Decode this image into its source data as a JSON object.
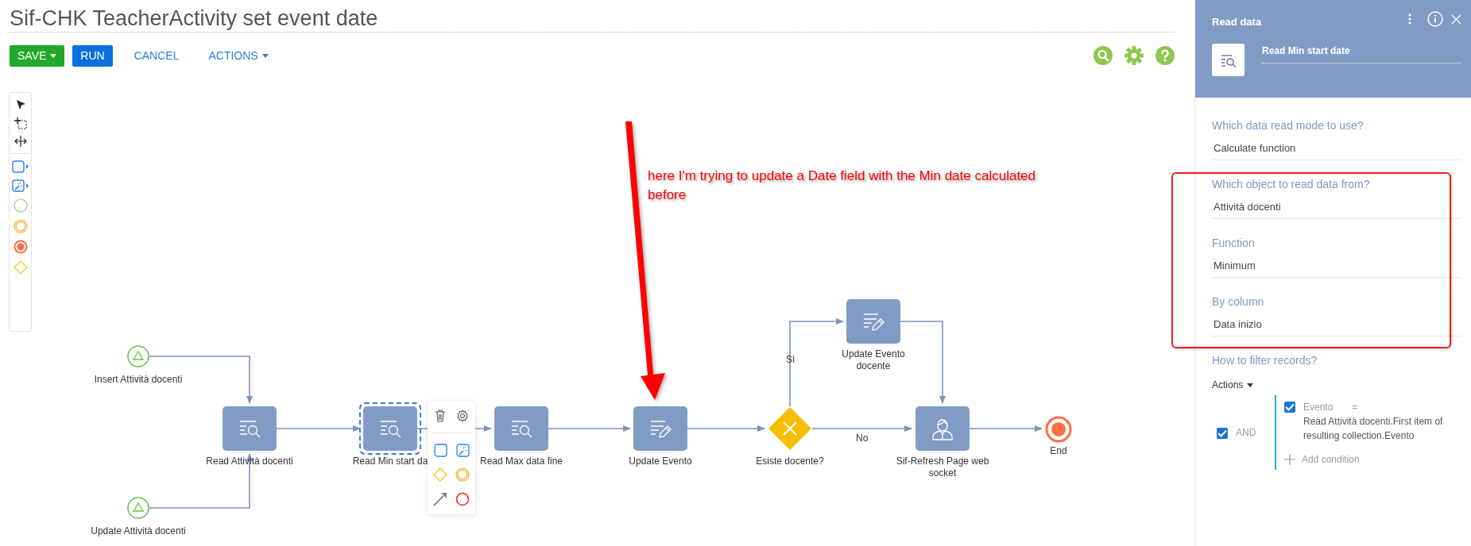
{
  "title": "Sif-CHK TeacherActivity set event date",
  "toolbar": {
    "buttons": [
      {
        "label": "SAVE",
        "kind": "primary-dropdown"
      },
      {
        "label": "RUN",
        "kind": "primary"
      },
      {
        "label": "CANCEL",
        "kind": "link"
      },
      {
        "label": "ACTIONS",
        "kind": "link-dropdown"
      }
    ]
  },
  "diagram": {
    "nodes": [
      {
        "kind": "start",
        "label": "Insert Attività docenti",
        "selected": false
      },
      {
        "kind": "start",
        "label": "Update Attività docenti",
        "selected": false
      },
      {
        "kind": "read",
        "label": "Read Attività docenti",
        "selected": false
      },
      {
        "kind": "read",
        "label": "Read Min start da",
        "selected": true
      },
      {
        "kind": "read",
        "label": "Read Max data fine",
        "selected": false
      },
      {
        "kind": "update",
        "label": "Update Evento",
        "selected": false
      },
      {
        "kind": "gateway",
        "label": "Esiste docente?",
        "selected": false
      },
      {
        "kind": "update",
        "label": "Update Evento docente",
        "selected": false
      },
      {
        "kind": "user",
        "label": "Sif-Refresh Page web socket",
        "selected": false
      },
      {
        "kind": "end",
        "label": "End",
        "selected": false
      }
    ],
    "flow_labels": [
      "Sì",
      "No"
    ]
  },
  "annotation": {
    "text": "here I'm trying to update a Date field with the Min date calculated before"
  },
  "panel": {
    "title": "Read data",
    "element_name": "Read Min start date",
    "fields": [
      {
        "label": "Which data read mode to use?",
        "value": "Calculate function"
      },
      {
        "label": "Which object to read data from?",
        "value": "Attività docenti"
      },
      {
        "label": "Function",
        "value": "Minimum"
      },
      {
        "label": "By column",
        "value": "Data inizio"
      }
    ],
    "filter_heading": "How to filter records?",
    "filter": {
      "actions": "Actions",
      "operator": "AND",
      "checked": true,
      "conditions": [
        {
          "column": "Evento",
          "comparison": "=",
          "value": "Read Attività docenti.First item of resulting collection.Evento",
          "checked": true
        }
      ],
      "add": "Add condition"
    }
  }
}
